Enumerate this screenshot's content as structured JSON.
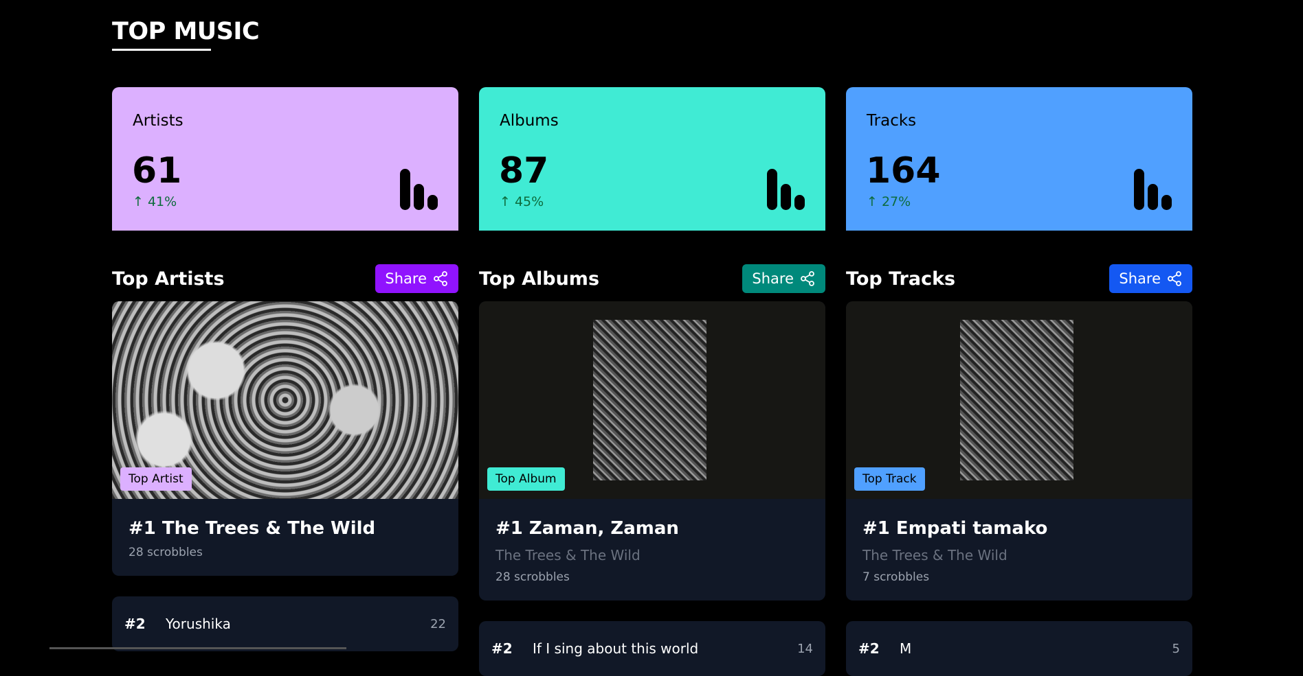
{
  "title": "TOP MUSIC",
  "stats": [
    {
      "label": "Artists",
      "value": "61",
      "change": "↑ 41%",
      "color": "#dcb0ff"
    },
    {
      "label": "Albums",
      "value": "87",
      "change": "↑ 45%",
      "color": "#40ebd4"
    },
    {
      "label": "Tracks",
      "value": "164",
      "change": "↑ 27%",
      "color": "#50a0ff"
    }
  ],
  "icons": {
    "bars": "bar-chart-icon",
    "share": "share-icon"
  },
  "columns": [
    {
      "title": "Top Artists",
      "share_label": "Share",
      "share_color": "#9013fe",
      "badge": "Top Artist",
      "badge_color": "#dcb0ff",
      "top_title": "#1 The Trees & The Wild",
      "top_sub": "",
      "top_scrobbles": "28 scrobbles",
      "list": [
        {
          "rank": "#2",
          "name": "Yorushika",
          "count": "22"
        }
      ]
    },
    {
      "title": "Top Albums",
      "share_label": "Share",
      "share_color": "#00897b",
      "badge": "Top Album",
      "badge_color": "#40ebd4",
      "top_title": "#1 Zaman, Zaman",
      "top_sub": "The Trees & The Wild",
      "top_scrobbles": "28 scrobbles",
      "list": [
        {
          "rank": "#2",
          "name": "If I sing about this world",
          "count": "14"
        }
      ]
    },
    {
      "title": "Top Tracks",
      "share_label": "Share",
      "share_color": "#1458f2",
      "badge": "Top Track",
      "badge_color": "#50a0ff",
      "top_title": "#1 Empati tamako",
      "top_sub": "The Trees & The Wild",
      "top_scrobbles": "7 scrobbles",
      "list": [
        {
          "rank": "#2",
          "name": "M",
          "count": "5"
        }
      ]
    }
  ]
}
